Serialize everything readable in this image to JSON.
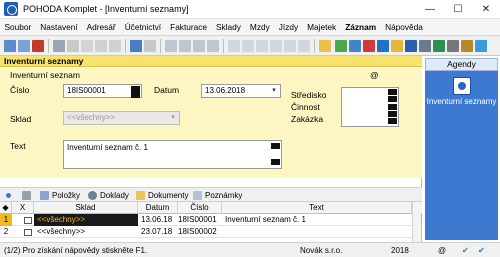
{
  "window": {
    "title": "POHODA Komplet - [Inventurní seznamy]",
    "controls": {
      "minimize": "—",
      "maximize": "☐",
      "close": "✕"
    }
  },
  "menu": [
    "Soubor",
    "Nastavení",
    "Adresář",
    "Účetnictví",
    "Fakturace",
    "Sklady",
    "Mzdy",
    "Jízdy",
    "Majetek",
    "Záznam",
    "Nápověda"
  ],
  "form": {
    "header": "Inventurní seznamy",
    "section_title": "Inventurní seznam",
    "number_label": "Číslo",
    "number_value": "18IS00001",
    "date_label": "Datum",
    "date_value": "13.06.2018",
    "warehouse_label": "Sklad",
    "warehouse_value": "<<všechny>>",
    "text_label": "Text",
    "text_value": "Inventurní seznam č. 1",
    "stredisko_label": "Středisko",
    "cinnost_label": "Činnost",
    "zakazka_label": "Zakázka",
    "at_symbol": "@"
  },
  "tabs": [
    {
      "label": "Položky",
      "icon": "grid-icon"
    },
    {
      "label": "Doklady",
      "icon": "documents-icon"
    },
    {
      "label": "Dokumenty",
      "icon": "folder-icon"
    },
    {
      "label": "Poznámky",
      "icon": "notes-icon"
    }
  ],
  "grid": {
    "columns": [
      "X",
      "Sklad",
      "Datum",
      "Číslo",
      "Text"
    ],
    "rows": [
      {
        "n": "1",
        "sklad": "<<všechny>>",
        "datum": "13.06.18",
        "cislo": "18IS00001",
        "text": "Inventurní seznam č. 1",
        "selected": true
      },
      {
        "n": "2",
        "sklad": "<<všechny>>",
        "datum": "23.07.18",
        "cislo": "18IS00002",
        "text": "",
        "selected": false
      }
    ]
  },
  "agendy": {
    "header": "Agendy",
    "item_label": "Inventurní seznamy",
    "item_icon": "inventory-icon"
  },
  "status": {
    "hint": "(1/2) Pro získání nápovědy stiskněte F1.",
    "company": "Novák s.r.o.",
    "year": "2018"
  },
  "colors": {
    "form_header": "#f7e36b",
    "form_bg": "#fdf6c3",
    "selected_row": "#f2b820",
    "agendy_bg": "#3d79d1"
  }
}
